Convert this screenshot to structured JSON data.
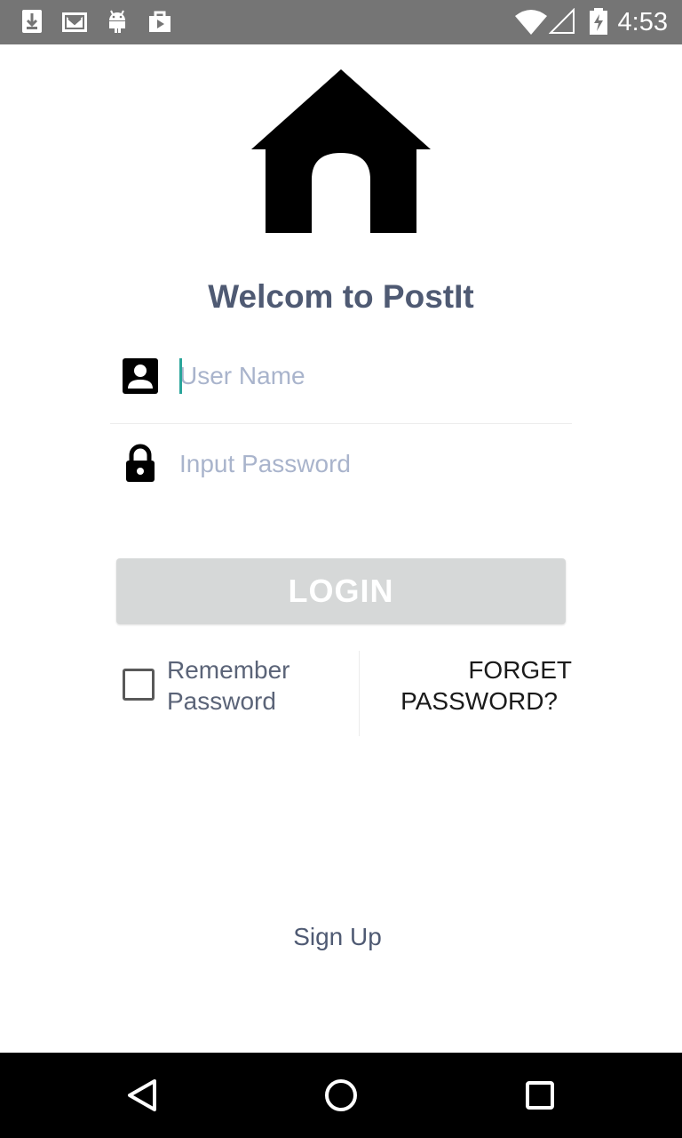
{
  "status_bar": {
    "time": "4:53",
    "left_icons": [
      "download-icon",
      "gmail-icon",
      "android-icon",
      "play-store-icon"
    ],
    "right_icons": [
      "wifi-icon",
      "signal-icon",
      "battery-icon"
    ],
    "background": "#757575"
  },
  "logo": {
    "icon": "house-icon"
  },
  "title": "Welcom to PostIt",
  "username": {
    "icon": "account-box-icon",
    "placeholder": "User Name",
    "value": ""
  },
  "password": {
    "icon": "lock-icon",
    "placeholder": "Input Password",
    "value": ""
  },
  "login": {
    "label": "LOGIN",
    "background": "#d6d8d8",
    "enabled": false
  },
  "remember": {
    "label_line1": "Remember",
    "label_line2": "Password",
    "checked": false
  },
  "forget": {
    "label_line1": "FORGET",
    "label_line2": "PASSWORD?"
  },
  "signup": {
    "label": "Sign Up"
  },
  "nav_bar": {
    "buttons": [
      "back-icon",
      "home-icon",
      "recents-icon"
    ]
  },
  "colors": {
    "title": "#4f5a73",
    "accent_cursor": "#2aa59a",
    "placeholder": "#a9b4cc"
  }
}
